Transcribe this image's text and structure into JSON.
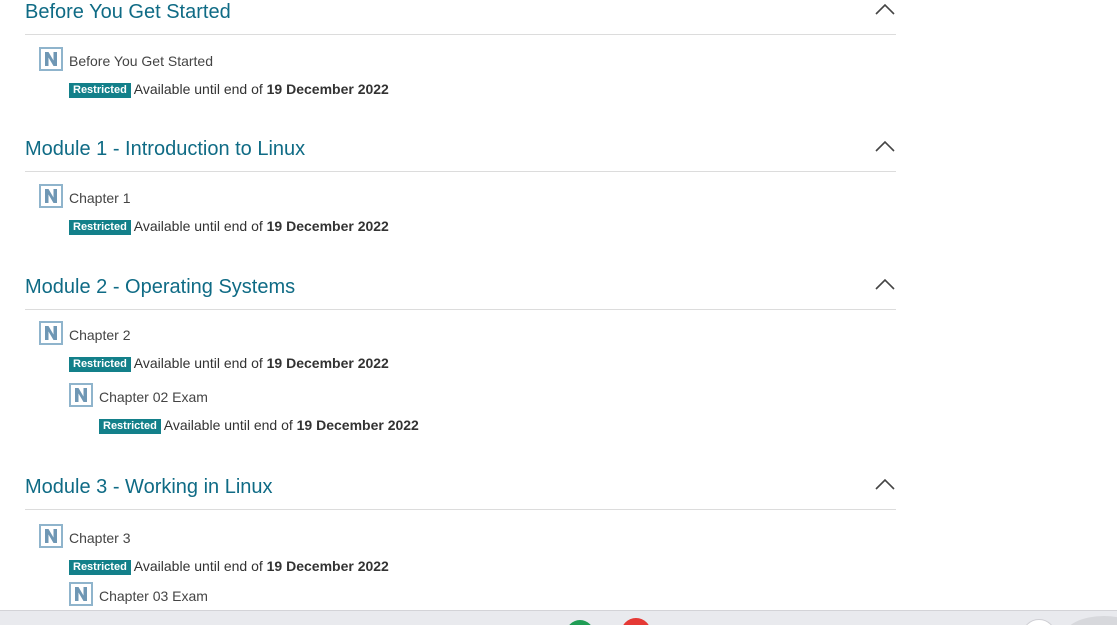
{
  "sections": [
    {
      "title": "Before You Get Started",
      "activities": [
        {
          "name": "Before You Get Started",
          "badge": "Restricted",
          "availability": "Available until end of",
          "date": "19 December 2022"
        }
      ]
    },
    {
      "title": "Module 1 - Introduction to Linux",
      "activities": [
        {
          "name": "Chapter 1",
          "badge": "Restricted",
          "availability": "Available until end of",
          "date": "19 December 2022"
        }
      ]
    },
    {
      "title": "Module 2 - Operating Systems",
      "activities": [
        {
          "name": "Chapter 2",
          "badge": "Restricted",
          "availability": "Available until end of",
          "date": "19 December 2022"
        },
        {
          "name": "Chapter 02 Exam",
          "badge": "Restricted",
          "availability": "Available until end of",
          "date": "19 December 2022"
        }
      ]
    },
    {
      "title": "Module 3 - Working in Linux",
      "activities": [
        {
          "name": "Chapter 3",
          "badge": "Restricted",
          "availability": "Available until end of",
          "date": "19 December 2022"
        },
        {
          "name": "Chapter 03 Exam"
        }
      ]
    }
  ],
  "icons": {
    "activity": "netacad-n-icon",
    "collapse": "chevron-up-icon"
  },
  "colors": {
    "section_title": "#0f6b85",
    "badge_bg": "#13808a",
    "icon_bg": "#8fb4cc",
    "taskbar_green": "#1f9d55",
    "taskbar_red": "#e53935"
  }
}
